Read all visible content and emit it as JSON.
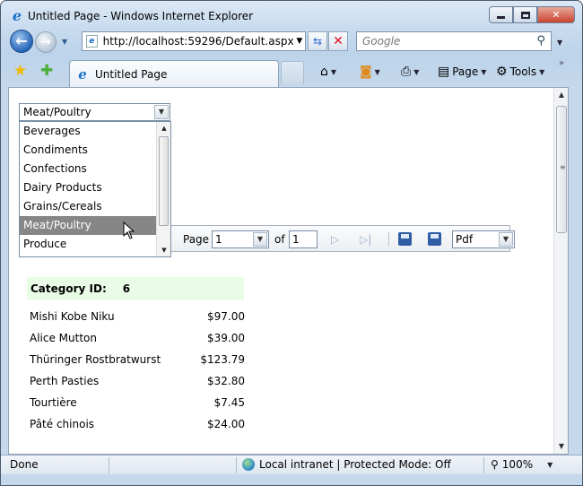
{
  "window": {
    "title": "Untitled Page - Windows Internet Explorer"
  },
  "navigation": {
    "address": "http://localhost:59296/Default.aspx",
    "search_placeholder": "Google"
  },
  "tabs": [
    {
      "label": "Untitled Page"
    }
  ],
  "command_bar": {
    "page_label": "Page",
    "tools_label": "Tools"
  },
  "category_select": {
    "selected": "Meat/Poultry",
    "options": [
      "Beverages",
      "Condiments",
      "Confections",
      "Dairy Products",
      "Grains/Cereals",
      "Meat/Poultry",
      "Produce"
    ]
  },
  "report_toolbar": {
    "page_label": "Page",
    "page_value": "1",
    "of_label": "of",
    "total_pages": "1",
    "export_format": "Pdf"
  },
  "report": {
    "category_label": "Category ID:",
    "category_id": "6",
    "products": [
      {
        "name": "Mishi Kobe Niku",
        "price": "$97.00"
      },
      {
        "name": "Alice Mutton",
        "price": "$39.00"
      },
      {
        "name": "Thüringer Rostbratwurst",
        "price": "$123.79"
      },
      {
        "name": "Perth Pasties",
        "price": "$32.80"
      },
      {
        "name": "Tourtière",
        "price": "$7.45"
      },
      {
        "name": "Pâté chinois",
        "price": "$24.00"
      }
    ]
  },
  "status": {
    "text": "Done",
    "zone": "Local intranet | Protected Mode: Off",
    "zoom": "100%"
  },
  "icons": {
    "back": "arrow-left",
    "forward": "arrow-right",
    "refresh": "refresh",
    "stop": "x",
    "search": "magnifier",
    "favorites": "star",
    "add_favorites": "star-plus",
    "home": "house",
    "feeds": "rss",
    "print": "printer",
    "page": "page",
    "tools": "gear",
    "save": "floppy-disk"
  },
  "colors": {
    "selected_item_bg": "#868686",
    "category_header_bg": "#e9fde6"
  }
}
